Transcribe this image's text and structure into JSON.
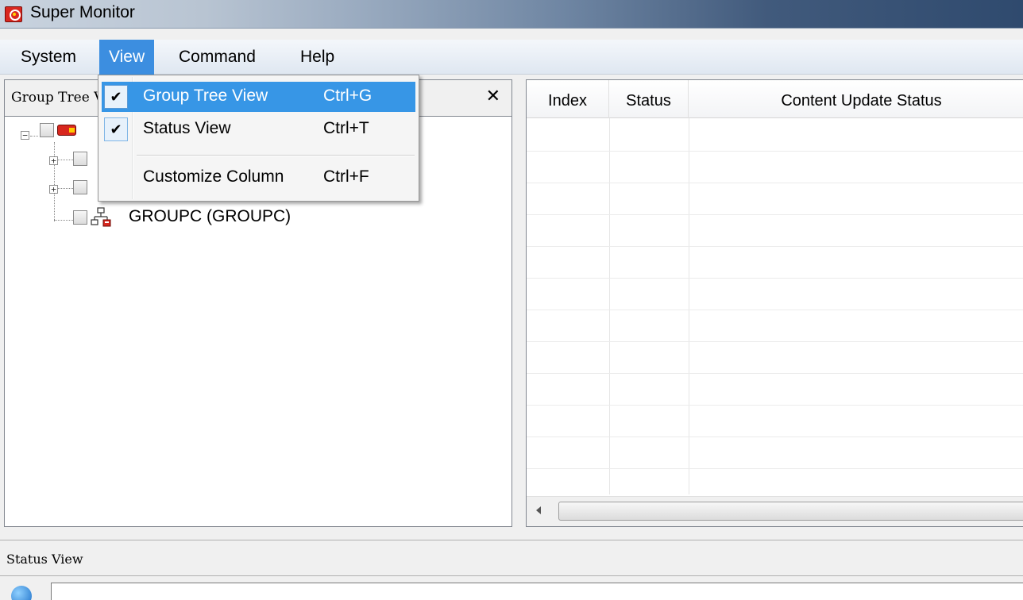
{
  "window": {
    "title": "Super Monitor"
  },
  "menubar": {
    "items": [
      {
        "label": "System"
      },
      {
        "label": "View"
      },
      {
        "label": "Command"
      },
      {
        "label": "Help"
      }
    ]
  },
  "view_menu": {
    "items": [
      {
        "label": "Group Tree View",
        "shortcut": "Ctrl+G",
        "checked": true,
        "check_glyph": "✔"
      },
      {
        "label": "Status View",
        "shortcut": "Ctrl+T",
        "checked": true,
        "check_glyph": "✔"
      },
      {
        "label": "Customize Column",
        "shortcut": "Ctrl+F",
        "checked": false
      }
    ]
  },
  "group_tree": {
    "title": "Group Tree View",
    "close_glyph": "✕",
    "nodes": [
      {
        "label": "GROUPC  (GROUPC)"
      }
    ]
  },
  "status_grid": {
    "columns": [
      {
        "label": "Index"
      },
      {
        "label": "Status"
      },
      {
        "label": "Content Update Status"
      }
    ]
  },
  "status_view": {
    "title": "Status View",
    "message": ""
  },
  "colors": {
    "accent": "#3796e6",
    "brand_red": "#d8271e"
  }
}
